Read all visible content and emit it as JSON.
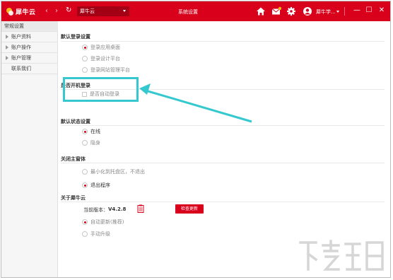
{
  "app": {
    "logo_text": "犀牛云",
    "address": "犀牛云",
    "window_title": "系统设置",
    "username": "犀牛学..."
  },
  "titlebar": {
    "back_glyph": "‹",
    "forward_glyph": "›",
    "refresh_glyph": "↻",
    "minimize_glyph": "—",
    "maximize_glyph": "☐",
    "close_glyph": "✕",
    "icons": [
      "home-icon",
      "mail-icon",
      "gear-icon",
      "user-icon"
    ]
  },
  "sidebar": {
    "items": [
      {
        "label": "常规设置",
        "active": true,
        "has_arrow": false
      },
      {
        "label": "账户资料",
        "active": false,
        "has_arrow": true
      },
      {
        "label": "账户操作",
        "active": false,
        "has_arrow": true
      },
      {
        "label": "账户管理",
        "active": false,
        "has_arrow": true
      },
      {
        "label": "联系我们",
        "active": false,
        "has_arrow": false
      }
    ]
  },
  "sections": {
    "default_login": {
      "title": "默认登录设置",
      "options": [
        {
          "label": "登录应用桌面",
          "selected": true
        },
        {
          "label": "登录设计平台",
          "selected": false
        },
        {
          "label": "登录网站管理平台",
          "selected": false
        }
      ]
    },
    "startup": {
      "title": "是否开机登录",
      "checkbox_label": "是否自动登录",
      "checked": false
    },
    "default_status": {
      "title": "默认状态设置",
      "options": [
        {
          "label": "在线",
          "selected": true
        },
        {
          "label": "隐身",
          "selected": false
        }
      ]
    },
    "close_main": {
      "title": "关闭主窗体",
      "options": [
        {
          "label": "最小化到托盘区，不退出",
          "selected": false
        },
        {
          "label": "退出程序",
          "selected": true
        }
      ]
    },
    "about": {
      "title": "关于犀牛云",
      "version_label": "当前版本：",
      "version_value": "V4.2.8",
      "check_update_label": "检查更新",
      "options": [
        {
          "label": "自动更新(推荐)",
          "selected": true
        },
        {
          "label": "手动升级",
          "selected": false
        }
      ]
    }
  },
  "colors": {
    "brand_red": "#d9001b",
    "highlight_cyan": "#35c9cf"
  }
}
